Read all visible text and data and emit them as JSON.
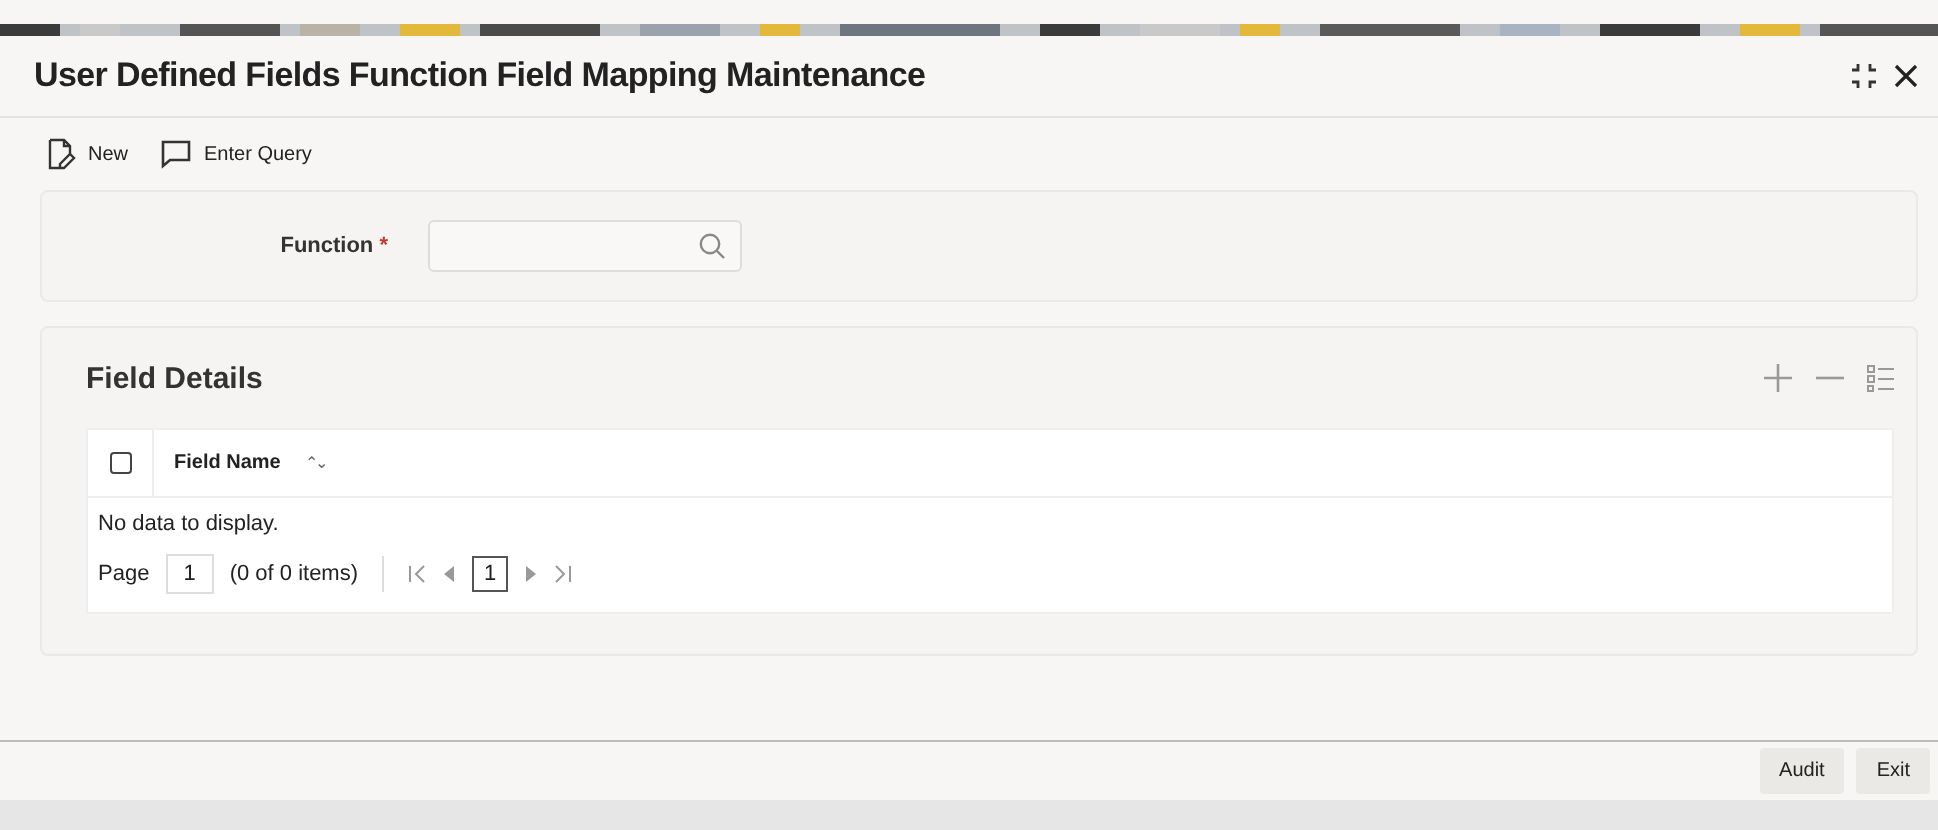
{
  "window": {
    "title": "User Defined Fields Function Field Mapping Maintenance"
  },
  "toolbar": [
    {
      "kind": "new",
      "label": "New"
    },
    {
      "kind": "query",
      "label": "Enter Query"
    }
  ],
  "function_field": {
    "label": "Function",
    "required_mark": "*"
  },
  "field_details": {
    "title": "Field Details",
    "table": {
      "columns": [
        {
          "label": "Field Name",
          "sort_icon": "⌃⌄"
        }
      ],
      "select_all": {
        "checked": false
      },
      "empty_message": "No data to display."
    },
    "pagination": {
      "page_label": "Page",
      "page_value": "1",
      "items": "(0 of 0 items)",
      "current_page": "1"
    }
  },
  "footer_buttons": [
    "Audit",
    "Exit"
  ]
}
